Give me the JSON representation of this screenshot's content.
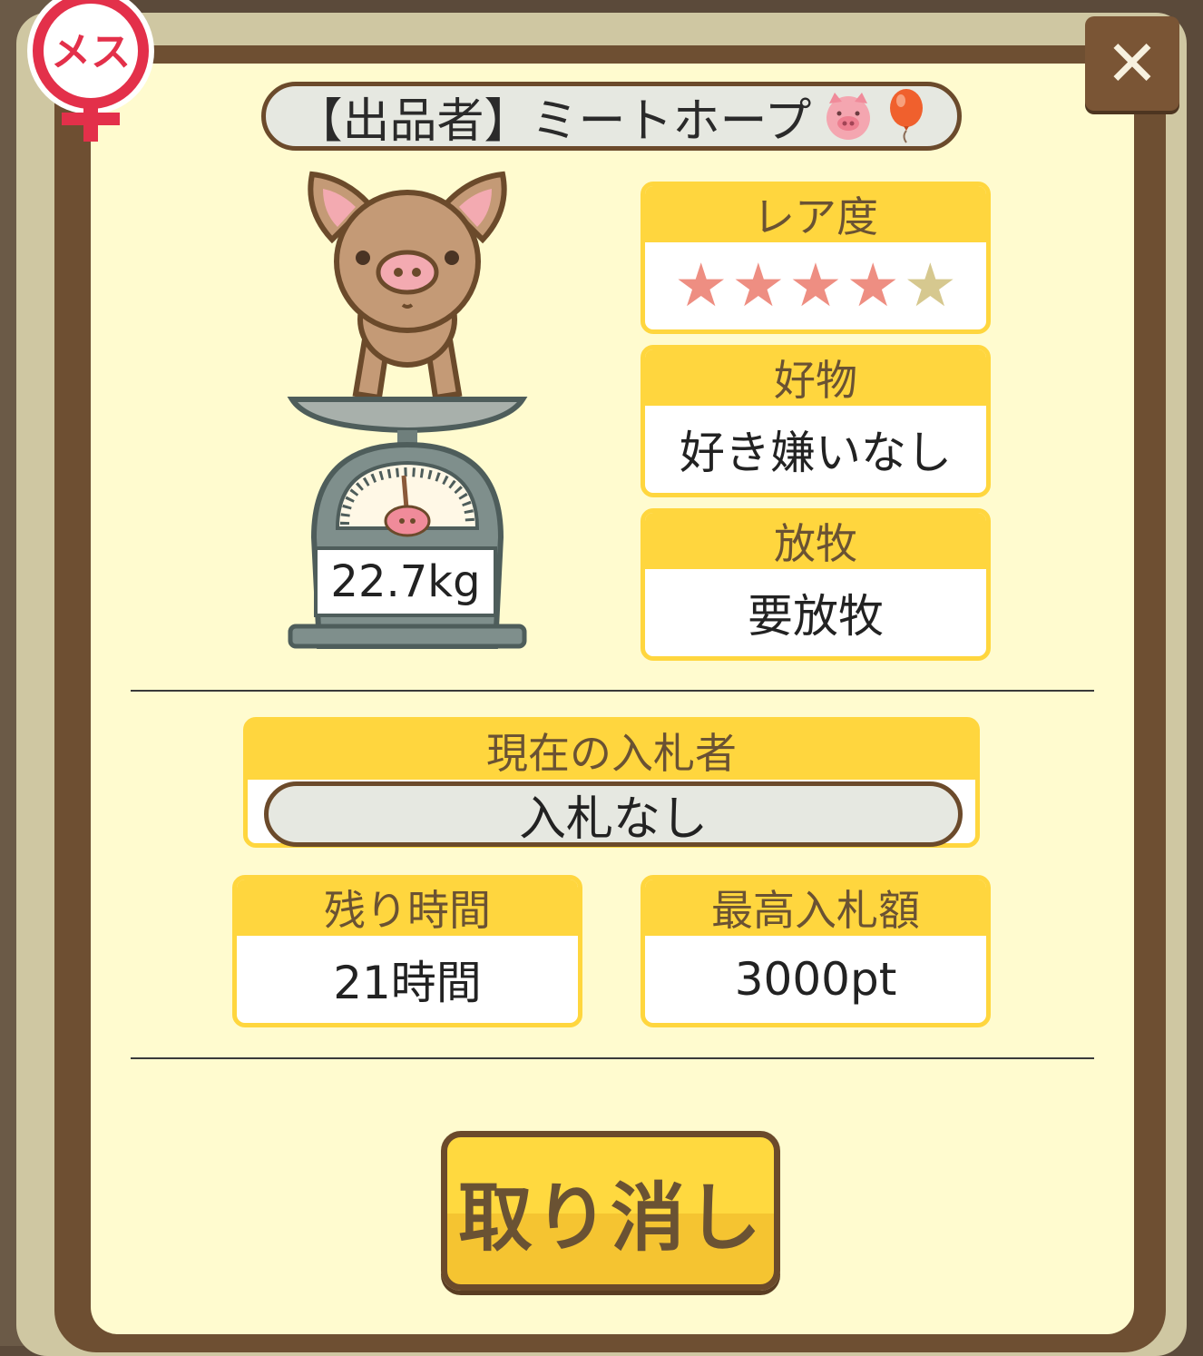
{
  "badge": {
    "sex_label": "メス",
    "color": "#e3304a"
  },
  "close": {
    "label": "✕"
  },
  "seller": {
    "text": "【出品者】ミートホープ"
  },
  "pig": {
    "weight": "22.7kg"
  },
  "rarity": {
    "title": "レア度",
    "stars_filled": 4,
    "stars_total": 5,
    "star_on_color": "#ee8e82",
    "star_off_color": "#d6c88f"
  },
  "favorite": {
    "title": "好物",
    "value": "好き嫌いなし"
  },
  "grazing": {
    "title": "放牧",
    "value": "要放牧"
  },
  "bidder": {
    "title": "現在の入札者",
    "value": "入札なし"
  },
  "remaining": {
    "title": "残り時間",
    "value": "21時間"
  },
  "highest_bid": {
    "title": "最高入札額",
    "value": "3000pt"
  },
  "cancel": {
    "label": "取り消し"
  }
}
